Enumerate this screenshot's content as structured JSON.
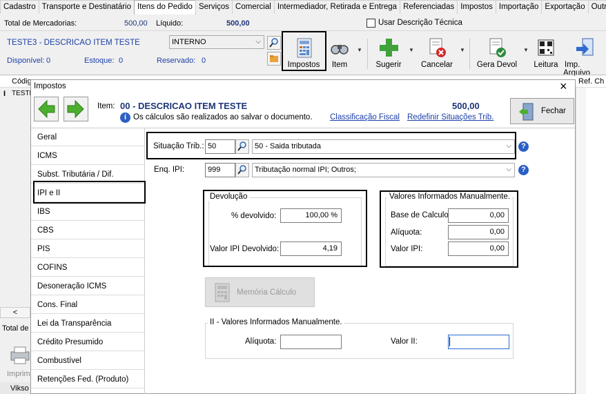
{
  "tabs": [
    "Cadastro",
    "Transporte e Destinatário",
    "Itens do Pedido",
    "Serviços",
    "Comercial",
    "Intermediador, Retirada e Entrega",
    "Referenciadas",
    "Impostos",
    "Importação",
    "Exportação",
    "Outros"
  ],
  "summary": {
    "total_merc_label": "Total de Mercadorias:",
    "total_merc_value": "500,00",
    "liquido_label": "Líquido:",
    "liquido_value": "500,00",
    "usar_desc": "Usar Descrição Técnica"
  },
  "item_row": {
    "desc": "TESTE3 - DESCRICAO ITEM TESTE",
    "interno": "INTERNO",
    "disp_label": "Disponível:",
    "disp_value": "0",
    "estoque_label": "Estoque:",
    "estoque_value": "0",
    "reservado_label": "Reservado:",
    "reservado_value": "0"
  },
  "toolbar": {
    "impostos": "Impostos",
    "item": "Item",
    "sugerir": "Sugerir",
    "cancelar": "Cancelar",
    "gera_devol": "Gera Devol",
    "leitura": "Leitura",
    "imp_arquivo": "Imp. Arquivo"
  },
  "behind": {
    "codigo": "Códig",
    "teste": "TESTE",
    "ref": "Ref. Ch",
    "total_de": "Total de",
    "imprim": "Imprim",
    "vikso": "Vikso"
  },
  "dialog": {
    "title": "Impostos",
    "close": "×",
    "item_label": "Item:",
    "item_title": "00 - DESCRICAO ITEM TESTE",
    "item_value": "500,00",
    "info": "Os cálculos são realizados ao salvar o documento.",
    "class_fiscal": "Classificação Fiscal",
    "redefinir": "Redefinir Situações Trib.",
    "fechar": "Fechar"
  },
  "sidebar": [
    "Geral",
    "ICMS",
    "Subst. Tributária / Dif. Alíquota",
    "IPI e II",
    "IBS",
    "CBS",
    "PIS",
    "COFINS",
    "Desoneração ICMS",
    "Cons. Final",
    "Lei da Transparência",
    "Crédito Presumido",
    "Combustível",
    "Retenções Fed. (Produto)"
  ],
  "form": {
    "sit_label": "Situação Trib.:",
    "sit_code": "50",
    "sit_desc": "50 - Saida tributada",
    "enq_label": "Enq. IPI:",
    "enq_code": "999",
    "enq_desc": "Tributação normal IPI; Outros;"
  },
  "devolucao": {
    "title": "Devolução",
    "pct_label": "% devolvido:",
    "pct_value": "100,00 %",
    "valor_label": "Valor IPI Devolvido:",
    "valor_value": "4,19"
  },
  "manual": {
    "title": "Valores Informados Manualmente.",
    "base_label": "Base de Calculo:",
    "base_value": "0,00",
    "aliq_label": "Alíquota:",
    "aliq_value": "0,00",
    "ipi_label": "Valor IPI:",
    "ipi_value": "0,00"
  },
  "memoria": "Memória Cálculo",
  "ii": {
    "title": "II - Valores Informados Manualmente.",
    "aliq_label": "Alíquota:",
    "aliq_value": "",
    "valor_label": "Valor II:",
    "valor_value": ""
  }
}
